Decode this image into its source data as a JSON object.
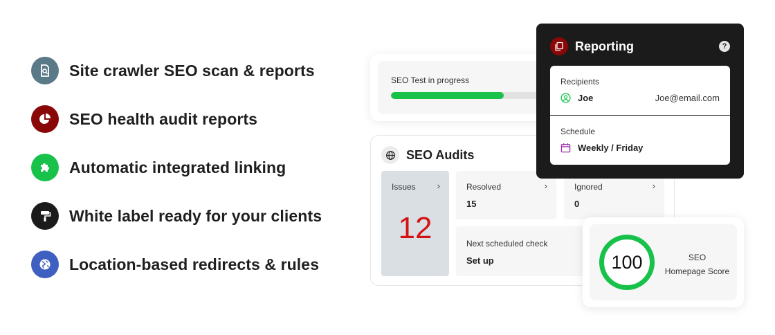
{
  "features": [
    {
      "label": "Site crawler SEO scan & reports",
      "icon": "document-search-icon",
      "color": "#5b7a88"
    },
    {
      "label": "SEO health audit reports",
      "icon": "pie-chart-icon",
      "color": "#8a0707"
    },
    {
      "label": "Automatic integrated linking",
      "icon": "puzzle-icon",
      "color": "#18c14a"
    },
    {
      "label": "White label ready for your clients",
      "icon": "paint-roller-icon",
      "color": "#1b1b1b"
    },
    {
      "label": "Location-based redirects & rules",
      "icon": "globe-icon",
      "color": "#3f5fc1"
    }
  ],
  "progress": {
    "title": "SEO Test in progress",
    "fraction": 0.68,
    "color": "#18c14a"
  },
  "audits": {
    "title": "SEO Audits",
    "issues": {
      "label": "Issues",
      "value": "12"
    },
    "resolved": {
      "label": "Resolved",
      "value": "15"
    },
    "ignored": {
      "label": "Ignored",
      "value": "0"
    },
    "next_check": {
      "label": "Next scheduled check",
      "value": "Set up"
    },
    "chevron": "›"
  },
  "reporting": {
    "title": "Reporting",
    "help": "?",
    "recipients_label": "Recipients",
    "recipient_name": "Joe",
    "recipient_email": "Joe@email.com",
    "schedule_label": "Schedule",
    "schedule_value": "Weekly / Friday"
  },
  "score": {
    "value": "100",
    "line1": "SEO",
    "line2": "Homepage Score"
  },
  "colors": {
    "accent_green": "#18c14a",
    "accent_red": "#d41212",
    "dark": "#1b1b1b",
    "purple": "#9b2fae"
  }
}
